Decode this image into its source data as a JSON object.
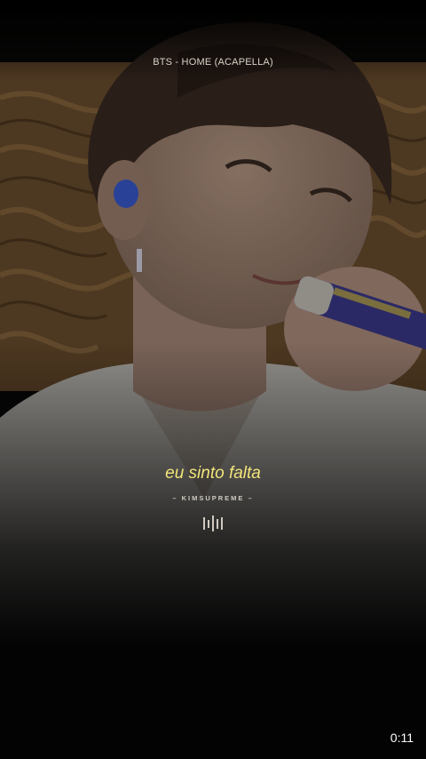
{
  "video": {
    "title": "BTS - HOME (ACAPELLA)",
    "lyric": "eu sinto falta",
    "credit": "– KIMSUPREME –",
    "timestamp": "0:11"
  },
  "colors": {
    "lyric": "#f2e57a",
    "background": "#050505",
    "wood": "#7a5a36"
  },
  "icons": {
    "audio_indicator": "audio-bars-icon"
  }
}
